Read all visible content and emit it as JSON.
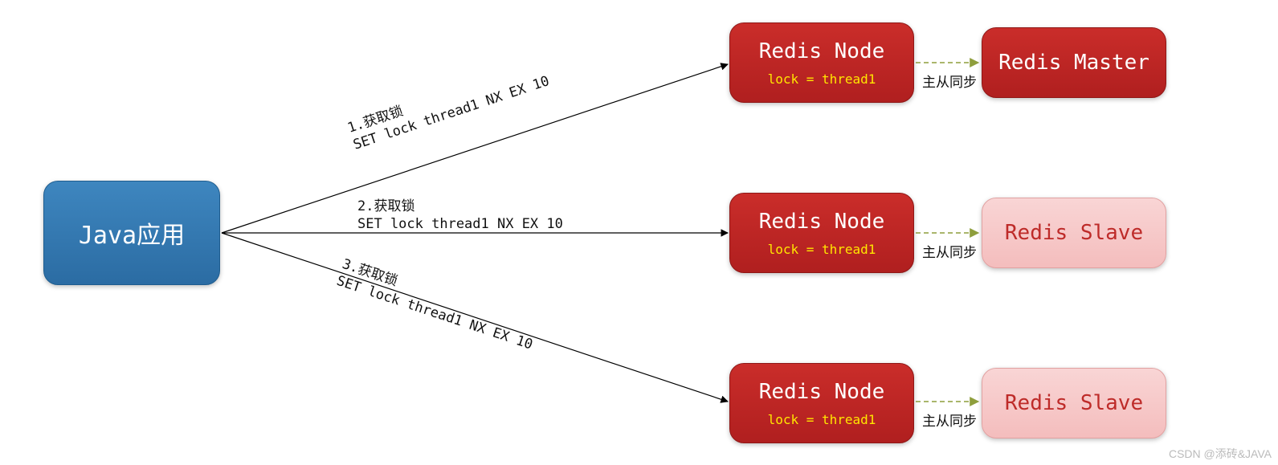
{
  "java_app": "Java应用",
  "arrows": {
    "a1": {
      "line1": "1.获取锁",
      "line2": "SET lock thread1 NX EX 10"
    },
    "a2": {
      "line1": "2.获取锁",
      "line2": "SET lock thread1 NX EX 10"
    },
    "a3": {
      "line1": "3.获取锁",
      "line2": "SET lock thread1 NX EX 10"
    }
  },
  "node1": {
    "title": "Redis Node",
    "lock": "lock = thread1"
  },
  "node2": {
    "title": "Redis Node",
    "lock": "lock = thread1"
  },
  "node3": {
    "title": "Redis Node",
    "lock": "lock = thread1"
  },
  "sync": "主从同步",
  "master": "Redis Master",
  "slave1": "Redis Slave",
  "slave2": "Redis Slave",
  "watermark": "CSDN @添砖&JAVA"
}
